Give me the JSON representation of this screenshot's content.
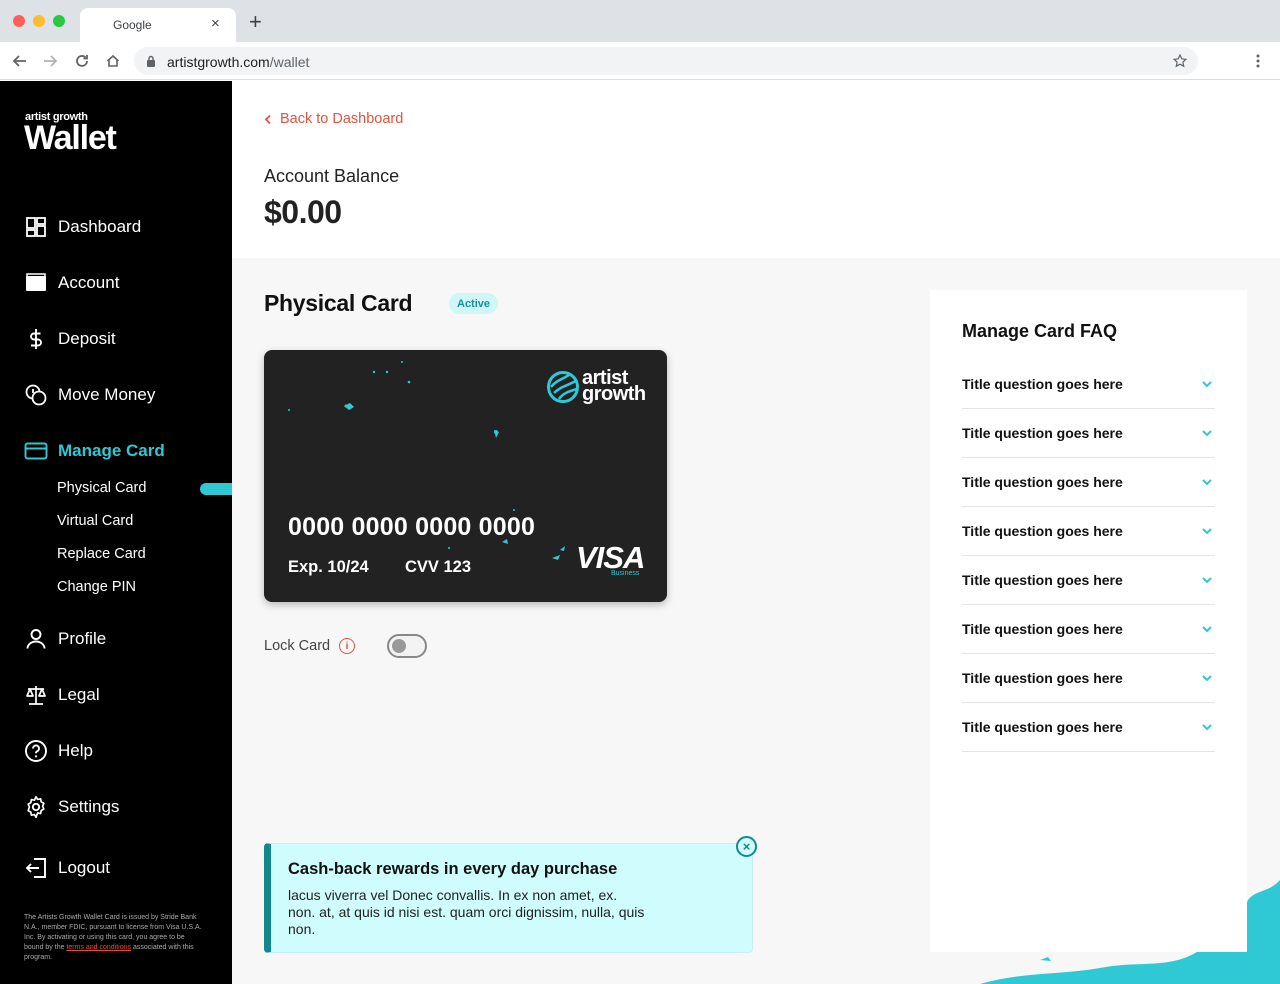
{
  "browser": {
    "tab_title": "Google",
    "tab_close": "×",
    "new_tab": "+",
    "url_domain": "artistgrowth.com",
    "url_path": "/wallet"
  },
  "sidebar": {
    "brand_small": "artist growth",
    "brand_big": "Wallet",
    "items": [
      {
        "label": "Dashboard",
        "icon": "dashboard-icon"
      },
      {
        "label": "Account",
        "icon": "wallet-icon"
      },
      {
        "label": "Deposit",
        "icon": "dollar-icon"
      },
      {
        "label": "Move Money",
        "icon": "coins-icon"
      },
      {
        "label": "Manage Card",
        "icon": "card-icon"
      },
      {
        "label": "Profile",
        "icon": "user-icon"
      },
      {
        "label": "Legal",
        "icon": "scales-icon"
      },
      {
        "label": "Help",
        "icon": "help-icon"
      },
      {
        "label": "Settings",
        "icon": "gear-icon"
      },
      {
        "label": "Logout",
        "icon": "logout-icon"
      }
    ],
    "sub_items": [
      "Physical Card",
      "Virtual Card",
      "Replace Card",
      "Change PIN"
    ],
    "disclaimer": "The Artists Growth Wallet Card is issued by Stride Bank N.A., member FDIC, pursuant to license from Visa U.S.A. Inc. By activating or using this card, you agree to be bound by the",
    "disclaimer_link": "terms and conditions",
    "disclaimer_end": "associated with this program."
  },
  "header": {
    "back_label": "Back to Dashboard",
    "balance_label": "Account Balance",
    "balance_value": "$0.00"
  },
  "card_section": {
    "title": "Physical Card",
    "status": "Active",
    "card_brand_line1": "artist",
    "card_brand_line2": "growth",
    "card_number": "0000 0000 0000 0000",
    "expiry": "Exp. 10/24",
    "cvv": "CVV 123",
    "network": "VISA",
    "network_sub": "Business",
    "lock_label": "Lock Card",
    "lock_info_glyph": "i"
  },
  "promo": {
    "title": "Cash-back rewards in every day purchase",
    "body": "lacus viverra vel Donec convallis. In ex non amet, ex. non. at, at quis id nisi est. quam orci dignissim, nulla, quis non.",
    "close_glyph": "×"
  },
  "faq": {
    "title": "Manage Card FAQ",
    "items": [
      "Title question goes here",
      "Title question goes here",
      "Title question goes here",
      "Title question goes here",
      "Title question goes here",
      "Title question goes here",
      "Title question goes here",
      "Title question goes here"
    ]
  },
  "colors": {
    "accent": "#2ec9d4",
    "link": "#e0533e",
    "promo_bg": "#cffcfd",
    "promo_border": "#15878f"
  }
}
